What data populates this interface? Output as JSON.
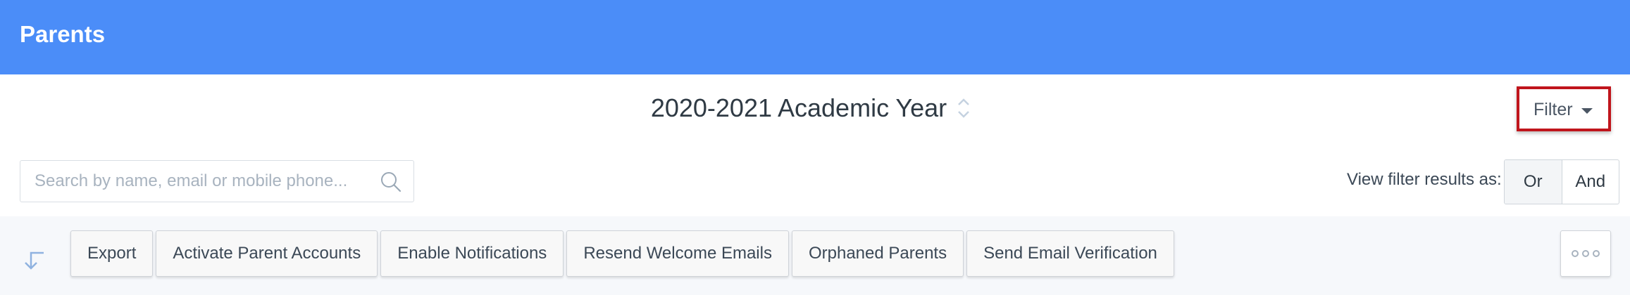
{
  "header": {
    "title": "Parents"
  },
  "academic_year": {
    "label": "2020-2021 Academic Year"
  },
  "filter": {
    "label": "Filter"
  },
  "search": {
    "placeholder": "Search by name, email or mobile phone...",
    "value": ""
  },
  "view_filter": {
    "label": "View filter results as:",
    "options": [
      "Or",
      "And"
    ]
  },
  "actions": {
    "buttons": [
      "Export",
      "Activate Parent Accounts",
      "Enable Notifications",
      "Resend Welcome Emails",
      "Orphaned Parents",
      "Send Email Verification"
    ]
  },
  "icons": {
    "spinner": "sort-arrows-icon",
    "search": "search-icon",
    "filter_caret": "caret-down-icon",
    "collapse": "arrow-down-left-icon",
    "more": "more-options-icon"
  },
  "colors": {
    "header_bg": "#4b8df8",
    "highlight_border": "#c0151c",
    "toolbar_bg": "#f6f8fb"
  }
}
